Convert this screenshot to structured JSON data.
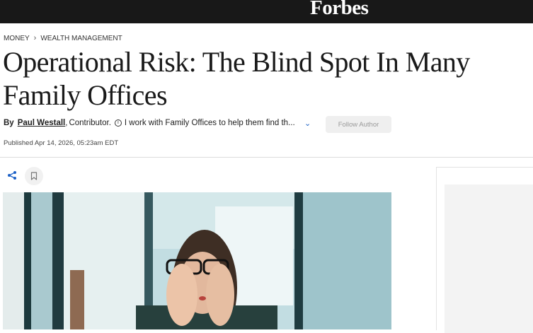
{
  "header": {
    "brand": "Forbes"
  },
  "breadcrumb": {
    "section": "MONEY",
    "subsection": "WEALTH MANAGEMENT"
  },
  "article": {
    "headline": "Operational Risk: The Blind Spot In Many Family Offices",
    "by_label": "By",
    "author": "Paul Westall",
    "comma": ",",
    "role": "Contributor.",
    "bio": "I work with Family Offices to help them find th...",
    "follow_label": "Follow Author",
    "published": "Published Apr 14, 2026, 05:23am EDT"
  },
  "icons": {
    "share": "share-icon",
    "bookmark": "bookmark-icon",
    "info": "info-icon",
    "expand": "chevron-down-icon"
  },
  "colors": {
    "topbar": "#181818",
    "accent": "#1c60c6",
    "follow_bg": "#efefef"
  }
}
